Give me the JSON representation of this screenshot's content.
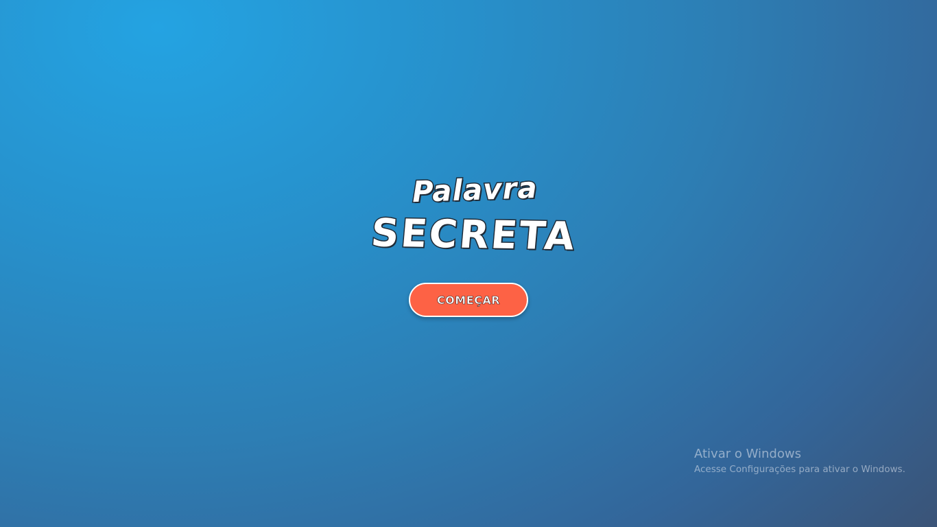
{
  "colors": {
    "background_light": "#24a3e2",
    "background_dark": "#3a5478",
    "button_fill": "#fd6245",
    "button_border": "#ffffff",
    "logo_text": "#ffffff",
    "logo_outline": "#1f2a36"
  },
  "logo": {
    "line1": "Palavra",
    "line2": "SECRETA"
  },
  "start_button": {
    "label": "COMEÇAR"
  },
  "windows_watermark": {
    "title": "Ativar o Windows",
    "subtitle": "Acesse Configurações para ativar o Windows."
  }
}
